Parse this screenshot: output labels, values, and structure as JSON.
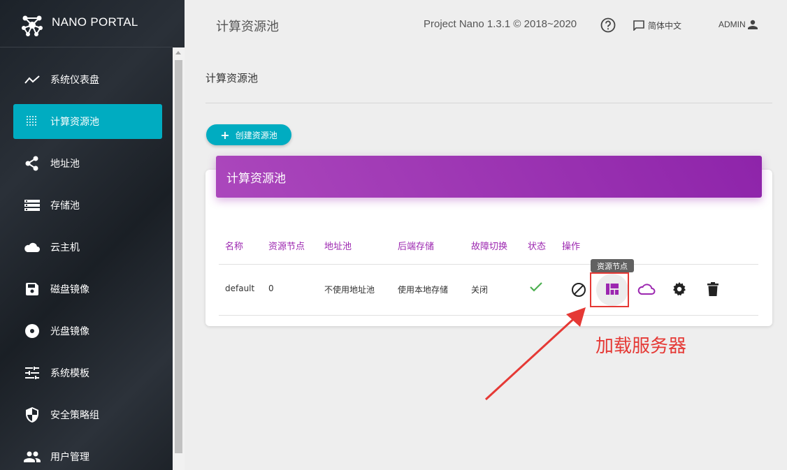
{
  "brand": {
    "name": "NANO PORTAL"
  },
  "sidebar": {
    "items": [
      {
        "label": "系统仪表盘",
        "icon": "trending-icon"
      },
      {
        "label": "计算资源池",
        "icon": "grid-dots-icon",
        "active": true
      },
      {
        "label": "地址池",
        "icon": "share-icon"
      },
      {
        "label": "存储池",
        "icon": "storage-list-icon"
      },
      {
        "label": "云主机",
        "icon": "cloud-icon"
      },
      {
        "label": "磁盘镜像",
        "icon": "save-icon"
      },
      {
        "label": "光盘镜像",
        "icon": "disc-icon"
      },
      {
        "label": "系统模板",
        "icon": "tune-icon"
      },
      {
        "label": "安全策略组",
        "icon": "security-shield-icon"
      },
      {
        "label": "用户管理",
        "icon": "people-icon"
      }
    ]
  },
  "header": {
    "title": "计算资源池",
    "version": "Project Nano 1.3.1 © 2018~2020",
    "language": "简体中文",
    "user": "ADMIN"
  },
  "page": {
    "title": "计算资源池",
    "create_button": "创建资源池"
  },
  "card": {
    "title": "计算资源池",
    "columns": [
      "名称",
      "资源节点",
      "地址池",
      "后端存储",
      "故障切换",
      "状态",
      "操作"
    ],
    "rows": [
      {
        "name": "default",
        "nodes": "0",
        "address_pool": "不使用地址池",
        "storage": "使用本地存储",
        "failover": "关闭",
        "status": "check-icon"
      }
    ],
    "operations": [
      "disable-icon",
      "resource-nodes-icon",
      "cloud-icon",
      "settings-icon",
      "delete-icon"
    ],
    "tooltip": "资源节点"
  },
  "annotation": {
    "text": "加载服务器",
    "color": "#e53935"
  },
  "colors": {
    "accent": "#00acc1",
    "purple": "#9c27b0",
    "sidebar_bg": "#1f252c"
  }
}
